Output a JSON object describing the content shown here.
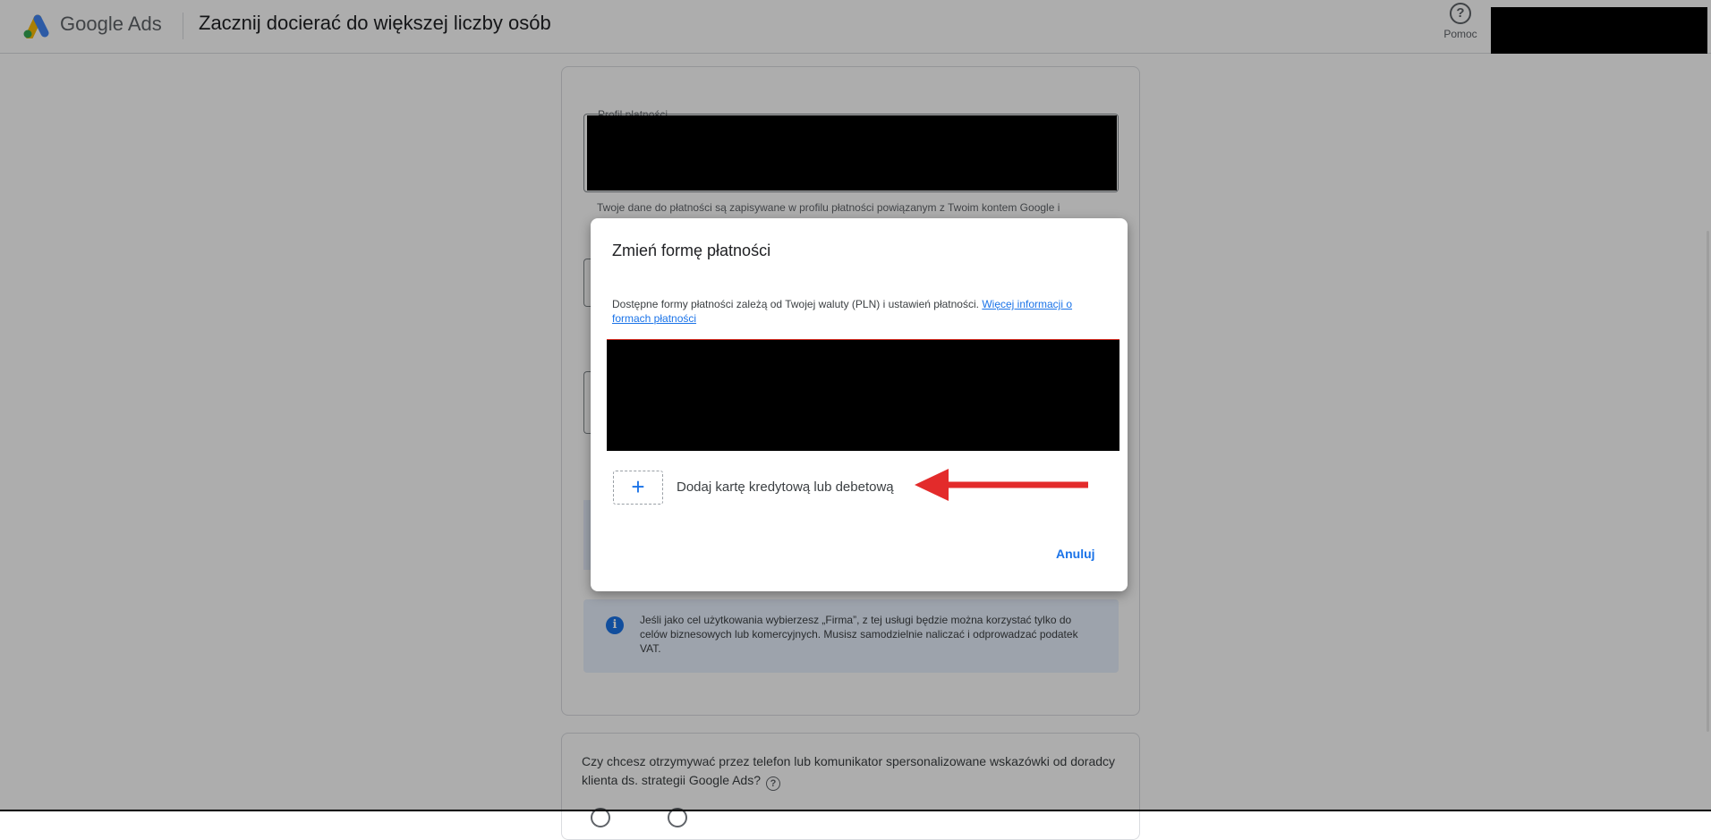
{
  "header": {
    "brand": "Google Ads",
    "title": "Zacznij docierać do większej liczby osób",
    "help_glyph": "?",
    "help_label": "Pomoc"
  },
  "billing": {
    "profile_label": "Profil płatności",
    "profile_help": "Twoje dane do płatności są zapisywane w profilu płatności powiązanym z Twoim kontem Google i"
  },
  "notice": {
    "icon_glyph": "i",
    "text": "Jeśli jako cel użytkowania wybierzesz „Firma”, z tej usługi będzie można korzystać tylko do celów biznesowych lub komercyjnych. Musisz samodzielnie naliczać i odprowadzać podatek VAT."
  },
  "advisor": {
    "question": "Czy chcesz otrzymywać przez telefon lub komunikator spersonalizowane wskazówki od doradcy klienta ds. strategii Google Ads?",
    "help_glyph": "?"
  },
  "dialog": {
    "title": "Zmień formę płatności",
    "description": "Dostępne formy płatności zależą od Twojej waluty (PLN) i ustawień płatności.",
    "link_text": "Więcej informacji o formach płatności",
    "add_icon": "+",
    "add_card_label": "Dodaj kartę kredytową lub debetową",
    "cancel_label": "Anuluj"
  },
  "colors": {
    "accent": "#1a73e8",
    "annotation_arrow": "#e32b2b",
    "scrim": "rgba(0,0,0,0.32)"
  }
}
